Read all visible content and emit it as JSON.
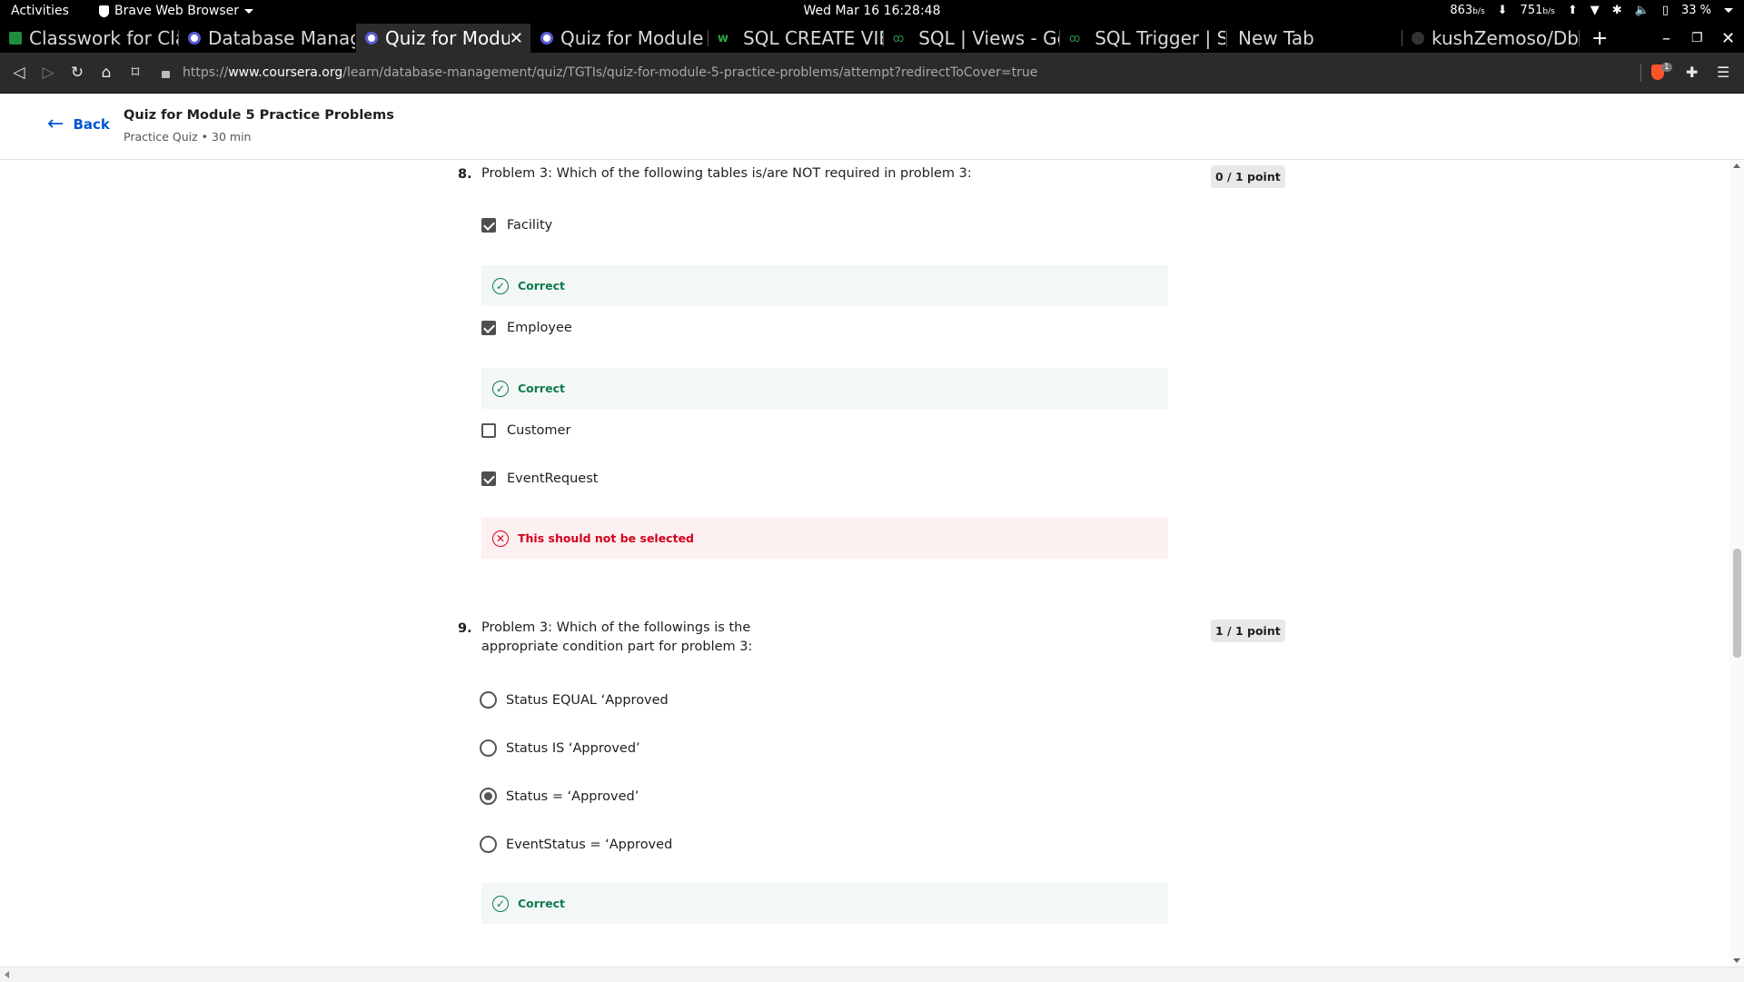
{
  "topbar": {
    "activities": "Activities",
    "app_name": "Brave Web Browser",
    "clock": "Wed Mar 16  16:28:48",
    "net_down": "863",
    "net_down_unit": "b/s",
    "net_up": "751",
    "net_up_unit": "b/s",
    "battery": "33 %"
  },
  "tabs": [
    {
      "title": "Classwork for Cla",
      "icon": "classroom-icon"
    },
    {
      "title": "Database Manage",
      "icon": "coursera-icon"
    },
    {
      "title": "Quiz for Modu",
      "icon": "coursera-icon",
      "active": true
    },
    {
      "title": "Quiz for Module",
      "icon": "coursera-icon"
    },
    {
      "title": "SQL CREATE VIEW",
      "icon": "w3schools-icon"
    },
    {
      "title": "SQL | Views - Gee",
      "icon": "geeksforgeeks-icon"
    },
    {
      "title": "SQL Trigger | Stu",
      "icon": "geeksforgeeks-icon"
    },
    {
      "title": "New Tab",
      "icon": ""
    },
    {
      "title": "kushZemoso/Dbr",
      "icon": "github-icon"
    }
  ],
  "toolbar": {
    "url_prefix": "https://",
    "url_host": "www.coursera.org",
    "url_path": "/learn/database-management/quiz/TGTIs/quiz-for-module-5-practice-problems/attempt?redirectToCover=true",
    "shields_count": "1"
  },
  "header": {
    "back_label": "Back",
    "title": "Quiz for Module 5 Practice Problems",
    "meta": "Practice Quiz • 30 min"
  },
  "questions": [
    {
      "number": "8.",
      "text": "Problem 3: Which of the following tables is/are NOT required in problem 3:",
      "points": "0 / 1 point",
      "options": [
        {
          "label": "Facility",
          "checked": true,
          "feedback": "Correct"
        },
        {
          "label": "Employee",
          "checked": true,
          "feedback": "Correct"
        },
        {
          "label": "Customer",
          "checked": false
        },
        {
          "label": "EventRequest",
          "checked": true,
          "feedback": "This should not be selected"
        }
      ]
    },
    {
      "number": "9.",
      "text_line1": "Problem 3: Which of the followings is the",
      "text_line2": "appropriate condition part for problem 3:",
      "points": "1 / 1 point",
      "options": [
        {
          "label": "Status EQUAL ‘Approved",
          "selected": false
        },
        {
          "label": "Status IS ‘Approved’",
          "selected": false
        },
        {
          "label": "Status = ‘Approved’",
          "selected": true
        },
        {
          "label": "EventStatus = ‘Approved",
          "selected": false
        }
      ],
      "feedback": "Correct"
    }
  ],
  "colors": {
    "link": "#0056d2",
    "correct": "#0f7a4b",
    "incorrect": "#d3001b",
    "correct_bg": "#f3f8f6",
    "incorrect_bg": "#fdf0f1"
  }
}
